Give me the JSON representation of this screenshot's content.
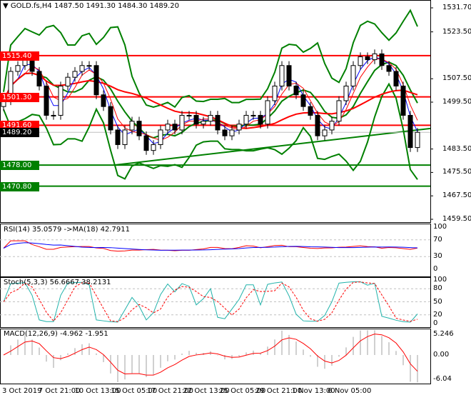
{
  "header": {
    "symbol": "GOLD.fs",
    "timeframe": "H4",
    "open": "1487.50",
    "high": "1491.30",
    "low": "1484.30",
    "close": "1489.20"
  },
  "rsi_label": "RSI(14) 35.0579  ->MA(18) 42.7911",
  "stoch_label": "Stoch(5,3,3) 56.6667 38.2131",
  "macd_label": "MACD(12,26,9) -4.962 -1.951",
  "chart_data": {
    "type": "candlestick",
    "price_axis": {
      "ticks": [
        "1531.70",
        "1523.50",
        "1507.50",
        "1499.50",
        "1483.50",
        "1475.50",
        "1467.50",
        "1459.50"
      ],
      "range": [
        1459.5,
        1531.7
      ]
    },
    "x_ticks": [
      "3 Oct 2019",
      "7 Oct 21:00",
      "10 Oct 13:00",
      "15 Oct 05:00",
      "17 Oct 21:00",
      "22 Oct 13:00",
      "25 Oct 05:00",
      "29 Oct 21:00",
      "1 Nov 13:00",
      "6 Nov 05:00"
    ],
    "closes": [
      1500,
      1510,
      1512,
      1515,
      1510,
      1505,
      1495,
      1495,
      1505,
      1508,
      1510,
      1512,
      1512,
      1502,
      1498,
      1490,
      1485,
      1490,
      1493,
      1488,
      1483,
      1485,
      1490,
      1492,
      1490,
      1495,
      1495,
      1492,
      1493,
      1495,
      1490,
      1488,
      1490,
      1492,
      1495,
      1495,
      1492,
      1500,
      1505,
      1512,
      1505,
      1502,
      1498,
      1495,
      1488,
      1490,
      1493,
      1500,
      1505,
      1512,
      1515,
      1514,
      1516,
      1512,
      1510,
      1505,
      1495,
      1484,
      1489.2
    ],
    "levels": [
      {
        "price": 1515.4,
        "label": "1515.40",
        "color": "#ff0000"
      },
      {
        "price": 1501.3,
        "label": "1501.30",
        "color": "#ff0000"
      },
      {
        "price": 1491.6,
        "label": "1491.60",
        "color": "#ff0000"
      },
      {
        "price": 1478.0,
        "label": "1478.00",
        "color": "#008000"
      },
      {
        "price": 1470.8,
        "label": "1470.80",
        "color": "#008000"
      }
    ],
    "current_price": {
      "price": 1489.2,
      "label": "1489.20",
      "color": "#000000"
    },
    "rsi": {
      "ticks": [
        "100",
        "70",
        "30",
        "0"
      ]
    },
    "stoch": {
      "ticks": [
        "100",
        "80",
        "50",
        "20",
        "0"
      ]
    },
    "macd": {
      "ticks": [
        "5.246",
        "0.00",
        "-6.04"
      ]
    }
  }
}
